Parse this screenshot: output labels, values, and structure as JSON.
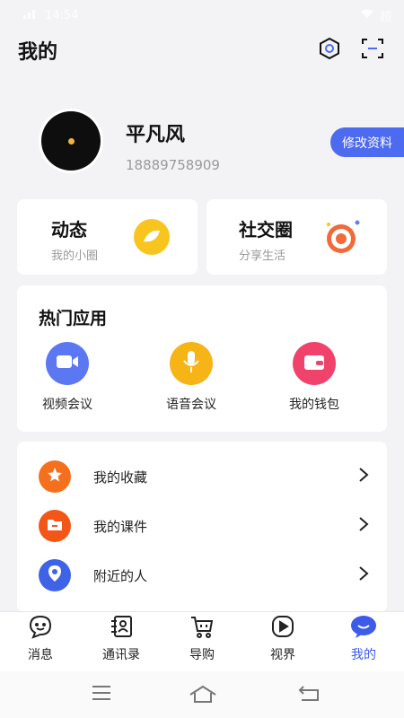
{
  "status_bar": {
    "time": "14:54",
    "battery": "超"
  },
  "header": {
    "title": "我的"
  },
  "profile": {
    "name": "平凡风",
    "phone": "18889758909",
    "edit_label": "修改资料"
  },
  "quick_cards": [
    {
      "title": "动态",
      "subtitle": "我的小圈"
    },
    {
      "title": "社交圈",
      "subtitle": "分享生活"
    }
  ],
  "hot_apps": {
    "title": "热门应用",
    "items": [
      {
        "label": "视频会议",
        "icon": "video-camera-icon",
        "color": "#5b78f2"
      },
      {
        "label": "语音会议",
        "icon": "microphone-icon",
        "color": "#f7b416"
      },
      {
        "label": "我的钱包",
        "icon": "wallet-icon",
        "color": "#f0426b"
      }
    ]
  },
  "menu": [
    {
      "label": "我的收藏",
      "icon": "star-icon",
      "color": "#f5701d"
    },
    {
      "label": "我的课件",
      "icon": "folder-icon",
      "color": "#f25717"
    },
    {
      "label": "附近的人",
      "icon": "location-pin-icon",
      "color": "#3f63e6"
    }
  ],
  "tabbar": [
    {
      "label": "消息",
      "icon": "message-icon"
    },
    {
      "label": "通讯录",
      "icon": "contacts-icon"
    },
    {
      "label": "导购",
      "icon": "shopping-cart-icon"
    },
    {
      "label": "视界",
      "icon": "play-icon"
    },
    {
      "label": "我的",
      "icon": "me-icon",
      "active": true
    }
  ],
  "colors": {
    "accent": "#4d6bf0",
    "active_tab": "#3b5be8",
    "background": "#f3f3f5"
  }
}
